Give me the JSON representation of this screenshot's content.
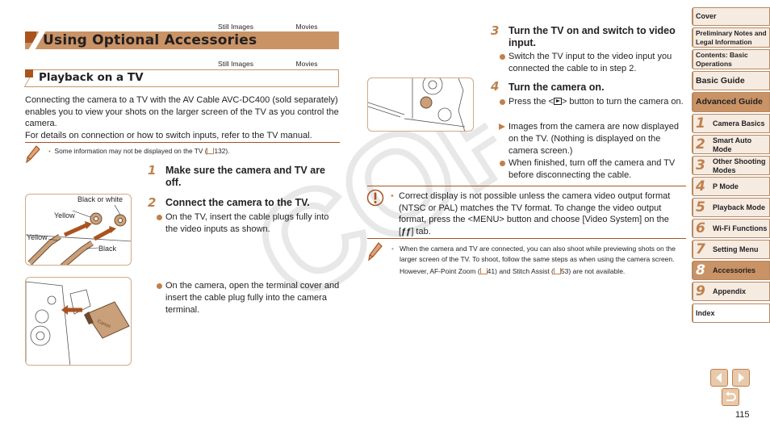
{
  "page": {
    "number": "115",
    "watermark": "COPY"
  },
  "tabs": {
    "still_images": "Still Images",
    "movies": "Movies"
  },
  "heading": {
    "title": "Using Optional Accessories",
    "subtitle": "Playback on a TV"
  },
  "intro": {
    "line1": "Connecting the camera to a TV with the AV Cable AVC-DC400 (sold separately) enables you to view your shots on the larger screen of the TV as you control the camera.",
    "line2": "For details on connection or how to switch inputs, refer to the TV manual."
  },
  "note1": {
    "text": "Some information may not be displayed on the TV (",
    "ref": "132",
    "tail": ")."
  },
  "illustration_labels": {
    "black_or_white": "Black or white",
    "yellow_top": "Yellow",
    "yellow_left": "Yellow",
    "black": "Black",
    "brand": "Canon"
  },
  "steps": [
    {
      "num": "1",
      "title": "Make sure the camera and TV are off."
    },
    {
      "num": "2",
      "title": "Connect the camera to the TV.",
      "bullets": [
        "On the TV, insert the cable plugs fully into the video inputs as shown.",
        "On the camera, open the terminal cover and insert the cable plug fully into the camera terminal."
      ]
    },
    {
      "num": "3",
      "title": "Turn the TV on and switch to video input.",
      "bullets": [
        "Switch the TV input to the video input you connected the cable to in step 2."
      ]
    },
    {
      "num": "4",
      "title": "Turn the camera on.",
      "bullets": [
        "Press the <",
        "> button to turn the camera on.",
        "Images from the camera are now displayed on the TV. (Nothing is displayed on the camera screen.)",
        "When finished, turn off the camera and TV before disconnecting the cable."
      ]
    }
  ],
  "caution": {
    "text": "Correct display is not possible unless the camera video output format (NTSC or PAL) matches the TV format. To change the video output format, press the <MENU> button and choose [Video System] on the [",
    "tab_glyph": "ƒƒ",
    "tail": "] tab."
  },
  "note2": {
    "line1": "When the camera and TV are connected, you can also shoot while previewing shots on the larger screen of the TV. To shoot, follow the same steps as when using the camera screen.",
    "line2a": "However, AF-Point Zoom (",
    "ref1": "41",
    "line2b": ") and Stitch Assist (",
    "ref2": "53",
    "line2c": ") are not available."
  },
  "sidebar": {
    "cover": "Cover",
    "prelim": "Preliminary Notes and Legal Information",
    "contents": "Contents: Basic Operations",
    "basic_guide": "Basic Guide",
    "advanced_guide": "Advanced Guide",
    "chapters": [
      {
        "num": "1",
        "label": "Camera Basics"
      },
      {
        "num": "2",
        "label": "Smart Auto Mode"
      },
      {
        "num": "3",
        "label": "Other Shooting Modes"
      },
      {
        "num": "4",
        "label": "P Mode"
      },
      {
        "num": "5",
        "label": "Playback Mode"
      },
      {
        "num": "6",
        "label": "Wi-Fi Functions"
      },
      {
        "num": "7",
        "label": "Setting Menu"
      },
      {
        "num": "8",
        "label": "Accessories",
        "active": true
      },
      {
        "num": "9",
        "label": "Appendix"
      }
    ],
    "index": "Index"
  },
  "colors": {
    "accent": "#c99366",
    "accent_dark": "#a9531e",
    "step_number": "#c0804c",
    "sidebar_bg": "#f5ebe1"
  }
}
